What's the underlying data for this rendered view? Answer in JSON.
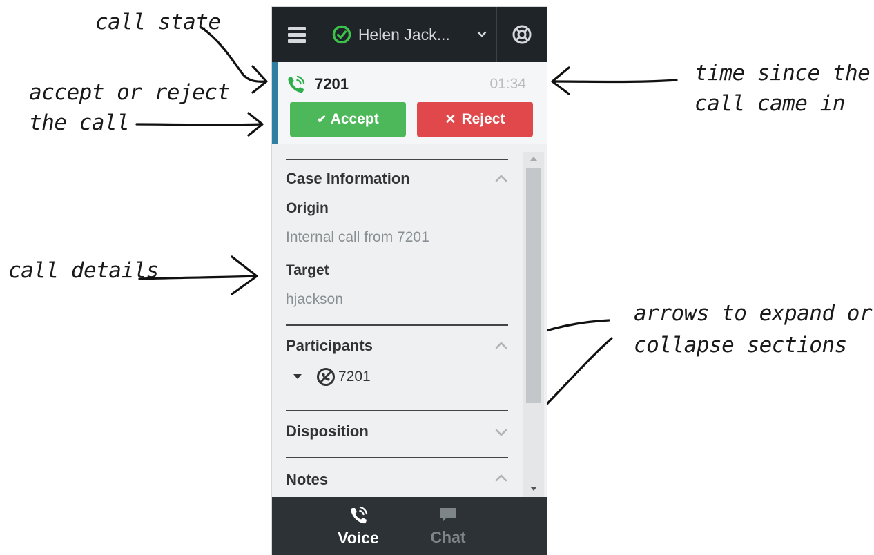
{
  "annotations": {
    "call_state": "call state",
    "accept_reject_1": "accept or reject",
    "accept_reject_2": "the call",
    "time_since_1": "time since the",
    "time_since_2": "call came in",
    "call_details": "call details",
    "arrows_expand_1": "arrows to expand or",
    "arrows_expand_2": "collapse sections"
  },
  "topbar": {
    "menu_icon": "hamburger-menu-icon",
    "agent_name": "Helen Jack...",
    "status_icon": "ready-check-icon",
    "status_color": "#3cc24a",
    "support_icon": "lifebuoy-icon"
  },
  "call": {
    "number": "7201",
    "timer": "01:34",
    "accept_label": "Accept",
    "reject_label": "Reject",
    "accent_color": "#2f7fa2",
    "accept_color": "#4db85a",
    "reject_color": "#e0484b"
  },
  "case_info": {
    "title": "Case Information",
    "origin_label": "Origin",
    "origin_value": "Internal call from 7201",
    "target_label": "Target",
    "target_value": "hjackson"
  },
  "participants": {
    "title": "Participants",
    "items": [
      {
        "name": "7201"
      }
    ]
  },
  "disposition": {
    "title": "Disposition"
  },
  "notes": {
    "title": "Notes"
  },
  "nav": {
    "voice_label": "Voice",
    "chat_label": "Chat"
  }
}
